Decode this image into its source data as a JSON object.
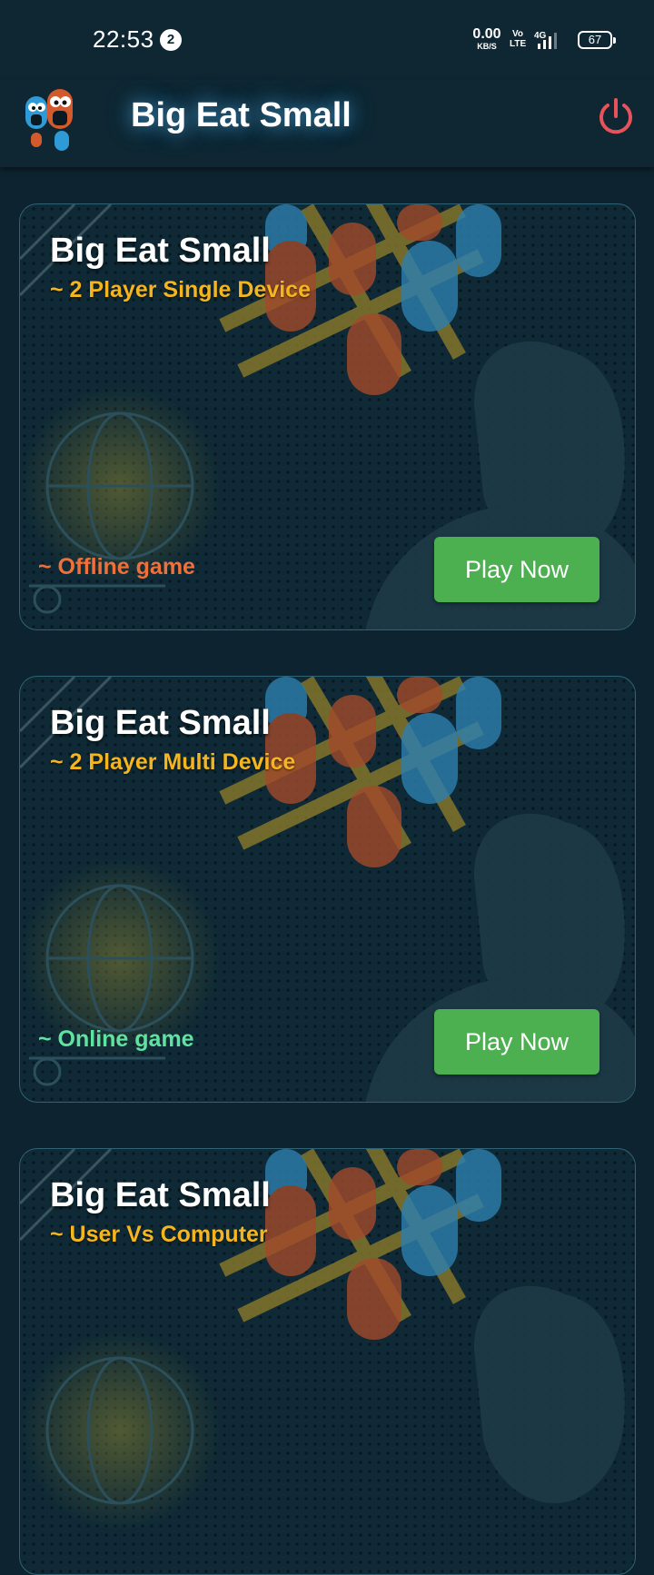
{
  "status_bar": {
    "time": "22:53",
    "notification_count": "2",
    "net_speed_value": "0.00",
    "net_speed_unit": "KB/S",
    "volte_top": "Vo",
    "volte_bottom": "LTE",
    "network_type": "4G",
    "battery_level": "67"
  },
  "header": {
    "title": "Big Eat Small",
    "power_icon": "power-icon"
  },
  "cards": [
    {
      "title": "Big Eat Small",
      "subtitle": "~ 2 Player Single Device",
      "mode": "~ Offline game",
      "button": "Play Now"
    },
    {
      "title": "Big Eat Small",
      "subtitle": "~ 2 Player Multi Device",
      "mode": "~ Online game",
      "button": "Play Now"
    },
    {
      "title": "Big Eat Small",
      "subtitle": "~ User Vs Computer"
    }
  ],
  "colors": {
    "background": "#0d2430",
    "subtitle": "#f5b51e",
    "offline": "#f0703a",
    "online": "#5ee3a0",
    "play_button": "#4caf50",
    "power_icon": "#e8525a"
  }
}
